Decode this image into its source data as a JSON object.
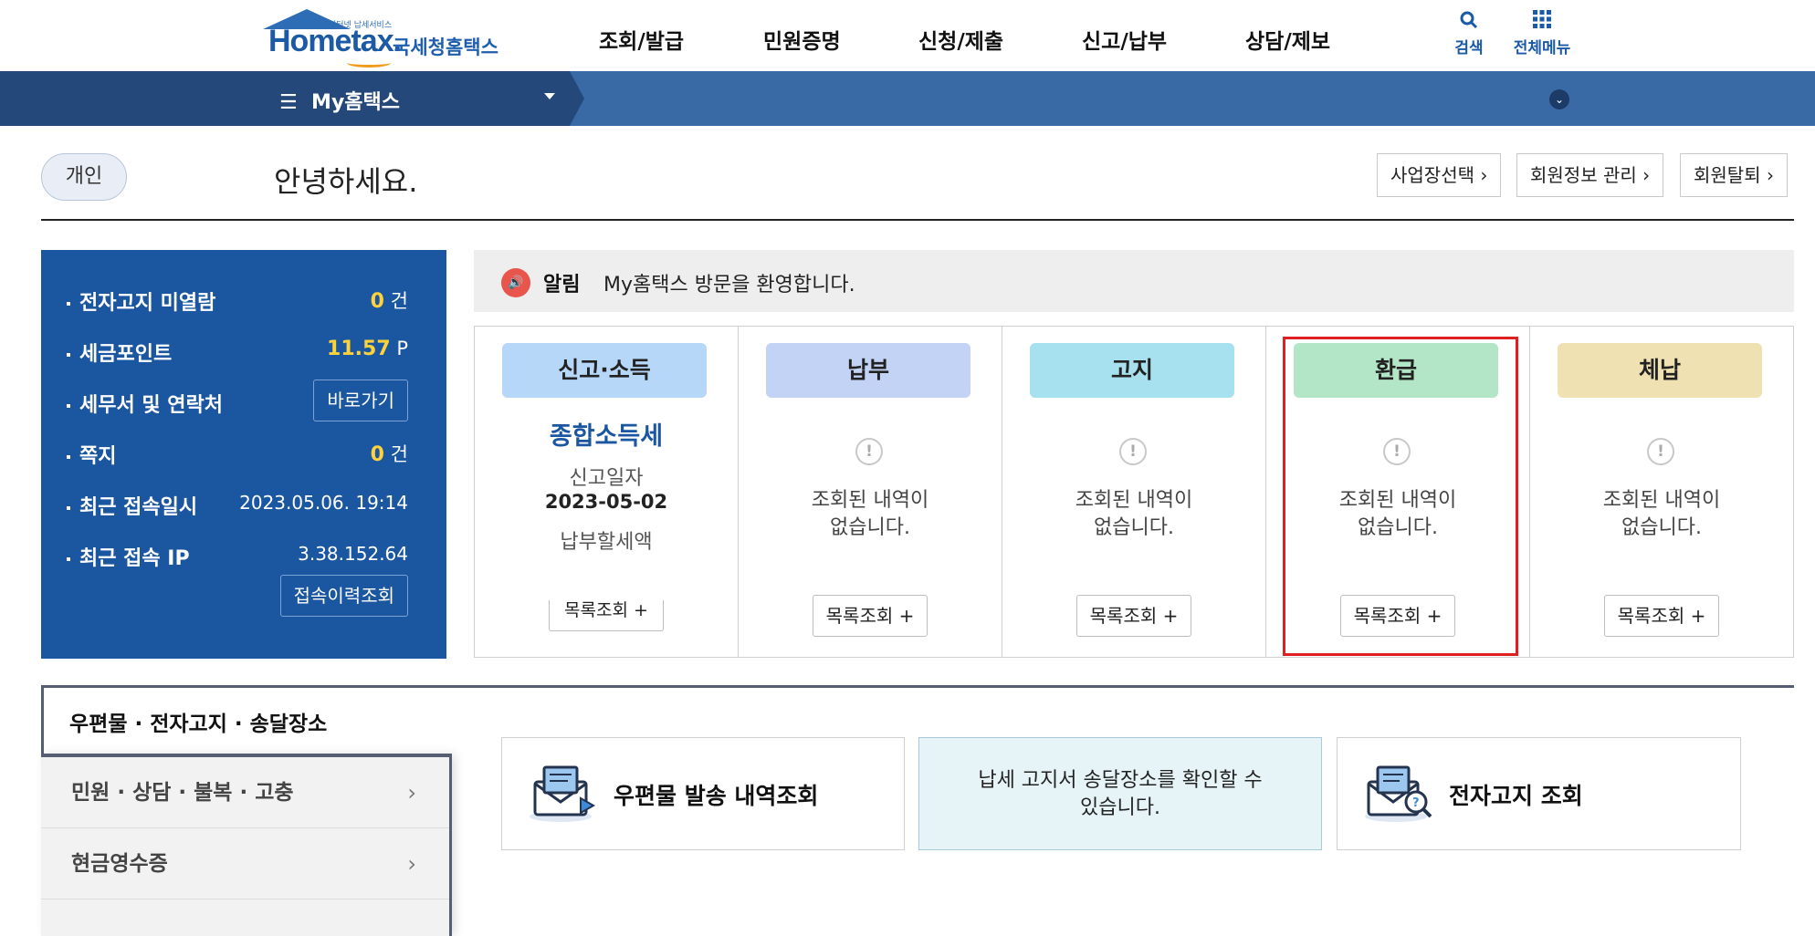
{
  "header": {
    "logo_small": "인터넷 납세서비스",
    "logo_main": "Hometax.",
    "logo_sub": "국세청홈택스",
    "nav": [
      "조회/발급",
      "민원증명",
      "신청/제출",
      "신고/납부",
      "상담/제보"
    ],
    "search_label": "검색",
    "menu_label": "전체메뉴"
  },
  "navbar": {
    "menu_icon": "hamburger-icon",
    "title": "My홈택스"
  },
  "greeting": {
    "type_label": "개인",
    "text": "안녕하세요.",
    "buttons": [
      "사업장선택",
      "회원정보 관리",
      "회원탈퇴"
    ]
  },
  "info_panel": {
    "rows": [
      {
        "label": "전자고지 미열람",
        "value": "0",
        "unit": "건"
      },
      {
        "label": "세금포인트",
        "value": "11.57",
        "unit": "P"
      },
      {
        "label": "세무서 및 연락처",
        "button": "바로가기"
      },
      {
        "label": "쪽지",
        "value": "0",
        "unit": "건"
      },
      {
        "label": "최근 접속일시",
        "text": "2023.05.06.  19:14"
      },
      {
        "label": "최근 접속 IP",
        "text": "3.38.152.64"
      }
    ],
    "history_button": "접속이력조회"
  },
  "alert": {
    "label": "알림",
    "text": "My홈택스 방문을 환영합니다."
  },
  "cards": [
    {
      "title": "신고·소득",
      "color": "#b6d7f7",
      "tax": "종합소득세",
      "line1": "신고일자",
      "line2": "2023-05-02",
      "line3": "납부할세액",
      "button": "목록조회 +"
    },
    {
      "title": "납부",
      "color": "#c3d3f5",
      "empty": [
        "조회된 내역이",
        "없습니다."
      ],
      "button": "목록조회 +"
    },
    {
      "title": "고지",
      "color": "#a7e0ee",
      "empty": [
        "조회된 내역이",
        "없습니다."
      ],
      "button": "목록조회 +"
    },
    {
      "title": "환급",
      "color": "#b3e6c6",
      "empty": [
        "조회된 내역이",
        "없습니다."
      ],
      "button": "목록조회 +"
    },
    {
      "title": "체납",
      "color": "#f0e1b2",
      "empty": [
        "조회된 내역이",
        "없습니다."
      ],
      "button": "목록조회 +"
    }
  ],
  "highlight_color": "#e02020",
  "bottom": {
    "tab": "우편물 · 전자고지 · 송달장소",
    "side_menu": [
      "민원 · 상담 · 불복 · 고충",
      "현금영수증"
    ],
    "services": [
      {
        "label": "우편물 발송 내역조회",
        "icon": "mail-send-icon"
      },
      {
        "info": [
          "납세 고지서 송달장소를 확인할 수",
          "있습니다."
        ]
      },
      {
        "label": "전자고지 조회",
        "icon": "mail-search-icon"
      }
    ]
  }
}
